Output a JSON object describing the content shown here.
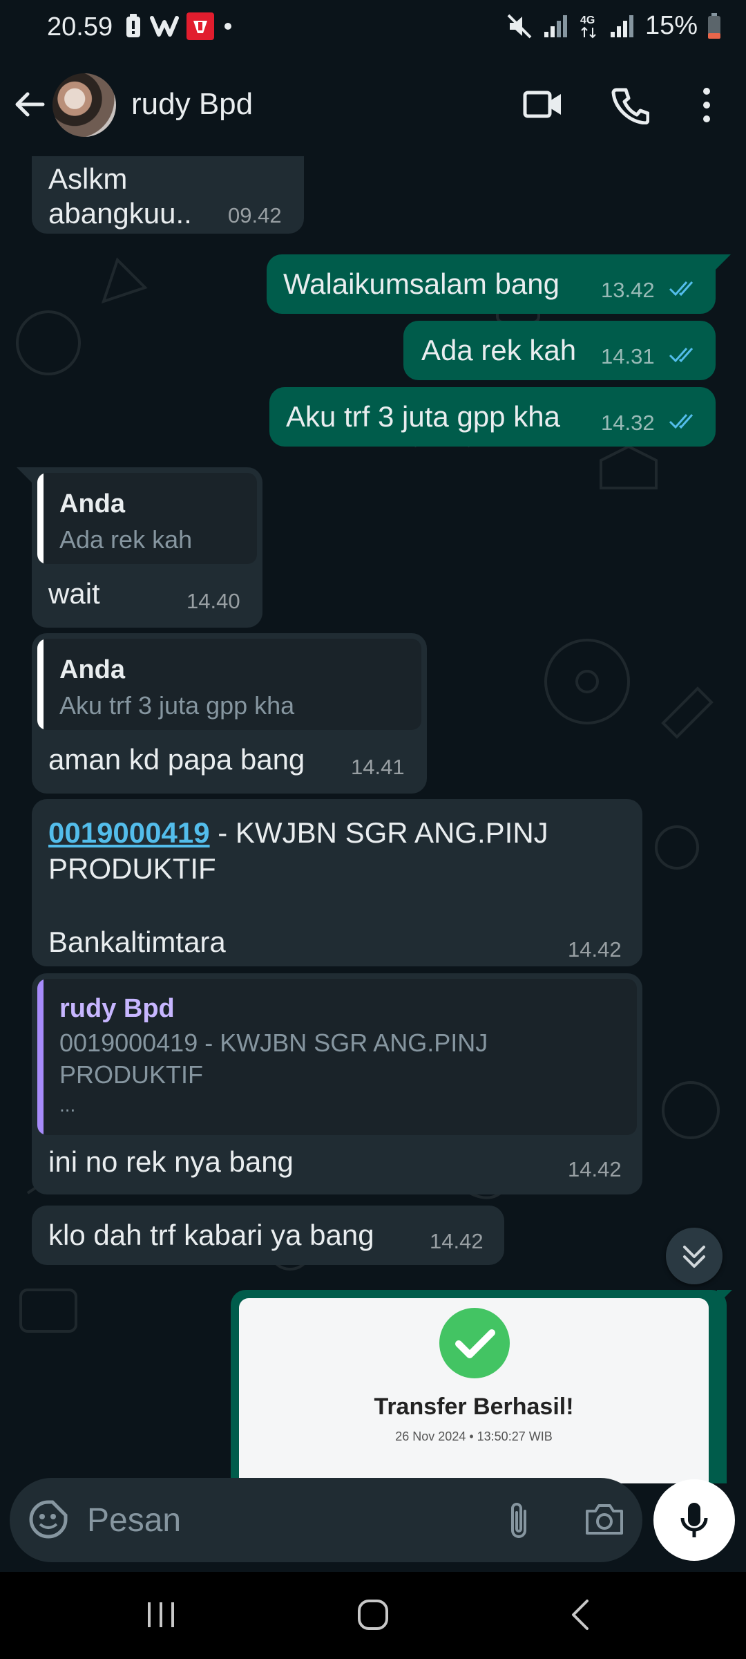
{
  "status_bar": {
    "time": "20.59",
    "battery_text": "15%",
    "icons": [
      "battery-saver-icon",
      "app-notification-icon",
      "app-notification-icon",
      "dot-icon",
      "mute-icon",
      "signal-icon",
      "4g-icon",
      "signal-icon",
      "battery-icon"
    ]
  },
  "header": {
    "contact_name": "rudy Bpd",
    "icons": [
      "back-arrow-icon",
      "avatar",
      "video-call-icon",
      "voice-call-icon",
      "more-menu-icon"
    ]
  },
  "messages": [
    {
      "dir": "in",
      "lines": [
        "Aslkm",
        "abangkuu.."
      ],
      "time": "09.42"
    },
    {
      "dir": "out",
      "text": "Walaikumsalam bang",
      "time": "13.42",
      "status": "read"
    },
    {
      "dir": "out",
      "text": "Ada rek kah",
      "time": "14.31",
      "status": "read"
    },
    {
      "dir": "out",
      "text": "Aku trf 3 juta gpp kha",
      "time": "14.32",
      "status": "read"
    },
    {
      "dir": "in",
      "quote_name": "Anda",
      "quote_text": "Ada rek kah",
      "text": "wait",
      "time": "14.40"
    },
    {
      "dir": "in",
      "quote_name": "Anda",
      "quote_text": "Aku trf 3 juta gpp kha",
      "text": "aman kd papa bang",
      "time": "14.41"
    },
    {
      "dir": "in",
      "link": "0019000419",
      "line1_rest": " - KWJBN SGR ANG.PINJ",
      "line2": "PRODUKTIF",
      "line3": "Bankaltimtara",
      "time": "14.42"
    },
    {
      "dir": "in",
      "quote_name": "rudy Bpd",
      "quote_lines": [
        "0019000419 - KWJBN SGR ANG.PINJ",
        "PRODUKTIF",
        "..."
      ],
      "text": "ini no rek nya bang",
      "time": "14.42"
    },
    {
      "dir": "in",
      "text": "klo dah trf kabari ya bang",
      "time": "14.42"
    }
  ],
  "receipt": {
    "title": "Transfer Berhasil!",
    "datetime": "26 Nov 2024 • 13:50:27 WIB"
  },
  "input": {
    "placeholder": "Pesan"
  },
  "colors": {
    "background": "#0b141a",
    "incoming_bubble": "#202c33",
    "outgoing_bubble": "#005c4b",
    "read_ticks": "#53bdeb",
    "quote_bar_rudy": "#a78bfa"
  }
}
